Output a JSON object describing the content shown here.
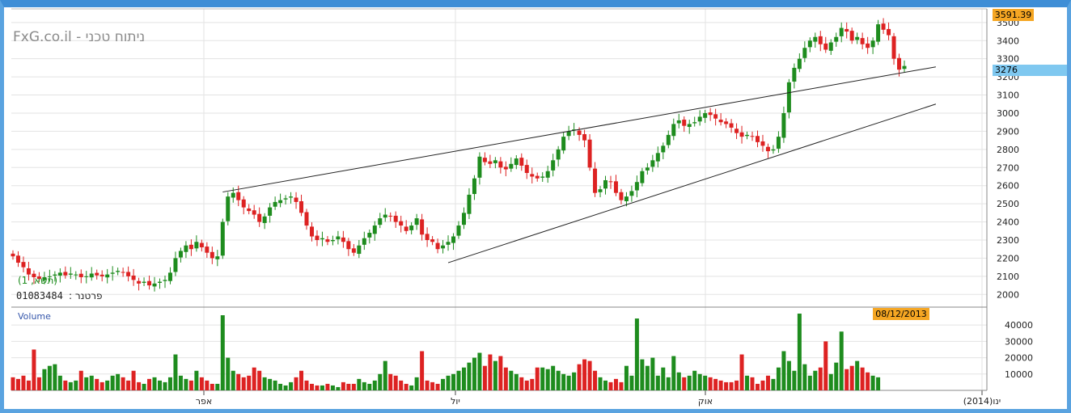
{
  "watermark": "FxG.co.il - ניתוח טכני",
  "partner_label": "פרטנר : 01083484",
  "partner_code": "01083484",
  "partner_prefix": "פרטנר",
  "indicator_label": "(1 ,תשא)",
  "last_price_tag": "3591.39",
  "current_price_tag": "3276",
  "date_tag": "08/12/2013",
  "volume_label": "Volume",
  "colors": {
    "up": "#1e8c1e",
    "down": "#dd2222",
    "price_tag_orange": "#f5a623",
    "current_tag_blue": "#7fc8f0",
    "frame": "#5aa3e0"
  },
  "chart_data": [
    {
      "type": "candlestick",
      "title": "",
      "y_ticks": [
        "2000",
        "2100",
        "2200",
        "2300",
        "2400",
        "2500",
        "2600",
        "2700",
        "2800",
        "2900",
        "3000",
        "3100",
        "3200",
        "3300",
        "3400",
        "3500"
      ],
      "ylim": [
        1930,
        3575
      ],
      "x_ticks": [
        "אפר",
        "יול",
        "אוק",
        "(2014)ינו"
      ],
      "grid": true,
      "series": [
        {
          "name": "price",
          "values": [
            2210,
            2175,
            2150,
            2110,
            2095,
            2085,
            2095,
            2100,
            2110,
            2120,
            2105,
            2115,
            2110,
            2095,
            2100,
            2115,
            2105,
            2100,
            2110,
            2120,
            2130,
            2120,
            2100,
            2080,
            2060,
            2070,
            2050,
            2060,
            2070,
            2080,
            2120,
            2200,
            2240,
            2270,
            2250,
            2290,
            2260,
            2230,
            2200,
            2210,
            2400,
            2540,
            2560,
            2520,
            2480,
            2460,
            2440,
            2400,
            2430,
            2480,
            2510,
            2520,
            2530,
            2540,
            2510,
            2450,
            2380,
            2320,
            2300,
            2310,
            2290,
            2300,
            2320,
            2290,
            2250,
            2230,
            2270,
            2310,
            2340,
            2380,
            2420,
            2440,
            2430,
            2400,
            2380,
            2350,
            2380,
            2420,
            2330,
            2300,
            2290,
            2250,
            2270,
            2290,
            2320,
            2380,
            2450,
            2550,
            2640,
            2760,
            2730,
            2720,
            2740,
            2700,
            2690,
            2720,
            2750,
            2710,
            2670,
            2650,
            2640,
            2650,
            2680,
            2740,
            2800,
            2870,
            2900,
            2910,
            2880,
            2850,
            2700,
            2560,
            2580,
            2630,
            2620,
            2560,
            2520,
            2540,
            2570,
            2620,
            2680,
            2700,
            2740,
            2780,
            2820,
            2880,
            2940,
            2960,
            2930,
            2940,
            2950,
            2980,
            3000,
            2990,
            2970,
            2950,
            2940,
            2920,
            2890,
            2870,
            2880,
            2870,
            2840,
            2820,
            2790,
            2800,
            2870,
            3000,
            3170,
            3250,
            3300,
            3360,
            3400,
            3420,
            3380,
            3350,
            3390,
            3420,
            3470,
            3450,
            3400,
            3420,
            3380,
            3360,
            3400,
            3490,
            3460,
            3430,
            3300,
            3240,
            3260
          ]
        },
        {
          "name": "volume",
          "values": [
            8000,
            7000,
            9000,
            6000,
            25000,
            8000,
            13000,
            15000,
            16000,
            9000,
            6000,
            5000,
            6000,
            12000,
            8000,
            9000,
            7000,
            5000,
            6000,
            9000,
            10000,
            8000,
            6000,
            12000,
            5000,
            4000,
            7000,
            8000,
            6000,
            5000,
            8000,
            22000,
            9000,
            7000,
            6000,
            12000,
            8000,
            6000,
            4000,
            4000,
            46000,
            20000,
            12000,
            10000,
            8000,
            9000,
            14000,
            12000,
            8000,
            7000,
            6000,
            4000,
            3000,
            5000,
            8000,
            12000,
            6000,
            4000,
            3000,
            3000,
            4000,
            3000,
            2000,
            5000,
            4000,
            4000,
            7000,
            5000,
            4000,
            6000,
            10000,
            18000,
            10000,
            9000,
            6000,
            4000,
            3000,
            8000,
            24000,
            6000,
            5000,
            4000,
            7000,
            9000,
            10000,
            12000,
            14000,
            17000,
            20000,
            23000,
            15000,
            22000,
            18000,
            21000,
            14000,
            12000,
            10000,
            8000,
            6000,
            7000,
            14000,
            14000,
            13000,
            15000,
            12000,
            10000,
            9000,
            11000,
            16000,
            19000,
            18000,
            12000,
            8000,
            6000,
            5000,
            7000,
            5000,
            15000,
            9000,
            44000,
            19000,
            15000,
            20000,
            9000,
            14000,
            8000,
            21000,
            11000,
            8000,
            9000,
            12000,
            10000,
            9000,
            8000,
            7000,
            6000,
            5000,
            5000,
            6000,
            22000,
            9000,
            8000,
            4000,
            6000,
            9000,
            7000,
            14000,
            24000,
            18000,
            12000,
            47000,
            16000,
            9000,
            12000,
            14000,
            30000,
            10000,
            17000,
            36000,
            13000,
            15000,
            18000,
            14000,
            11000,
            9000,
            8000
          ]
        }
      ],
      "volume_ticks": [
        "10000",
        "20000",
        "30000",
        "40000"
      ],
      "volume_ylim": [
        0,
        48000
      ]
    }
  ]
}
